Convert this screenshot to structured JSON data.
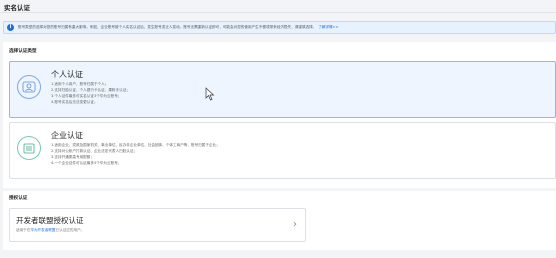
{
  "page": {
    "title": "实名认证"
  },
  "notice": {
    "text": "账号类型的选择对您的账号归属有重大影响。例如，企业账号被个人实名认证后，发生账号变迁人变动，账号无需重新认证即可，可能会对您的使用产生不便或带来经济损失，请谨慎选择。",
    "link": "了解详情>>"
  },
  "select_section": {
    "label": "选择认证类型"
  },
  "personal": {
    "title": "个人认证",
    "lines": [
      "1.适用个人用户，账号归属于个人；",
      "2.支持扫脸认证、个人银行卡认证、果粉手认证；",
      "3.个人证件最多可实名认证3个华为云账号；",
      "4.账号实名后无法变更认证。"
    ]
  },
  "enterprise": {
    "title": "企业认证",
    "lines": [
      "1.适用企业、党政及国家机关、事业单位、民办非企业单位、社会团体、个体工商户等，账号归属于企业；",
      "2.支持对公帐户打款认证、企业法定代表人扫脸认证；",
      "3.支持开通更高专用配额；",
      "4.一个企业证件可认证最多5个华为云账号。"
    ]
  },
  "auth_section": {
    "label": "授权认证"
  },
  "developer": {
    "title": "开发者联盟授权认证",
    "desc_prefix": "适用于在",
    "desc_link": "华为开发者联盟",
    "desc_suffix": "已认证过的用户。",
    "chevron": "›"
  },
  "icons": {
    "notice": "info-icon",
    "personal": "person-icon",
    "enterprise": "building-icon",
    "cursor": "mouse-cursor-icon"
  },
  "colors": {
    "accent": "#1e6fd9",
    "selected_bg": "#eef5ff",
    "enterprise_icon": "#3fae8a"
  }
}
